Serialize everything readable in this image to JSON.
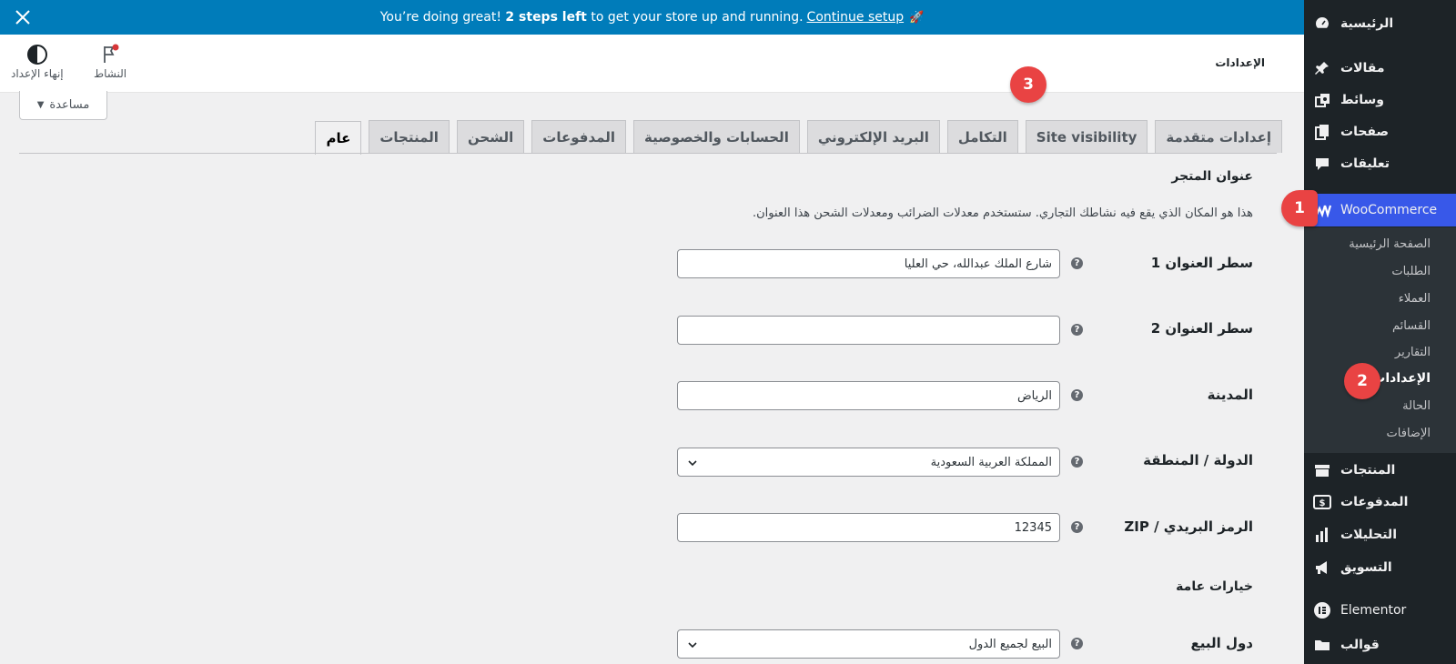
{
  "banner": {
    "text_before": "You’re doing great! ",
    "text_bold": "2 steps left",
    "text_after": " to get your store up and running. ",
    "link": "Continue setup",
    "emoji": "🚀"
  },
  "header": {
    "title": "الإعدادات",
    "activity_label": "النشاط",
    "finish_setup_label": "إنهاء الإعداد",
    "help_label": "مساعدة"
  },
  "tabs": [
    {
      "label": "عام",
      "active": true
    },
    {
      "label": "المنتجات"
    },
    {
      "label": "الشحن"
    },
    {
      "label": "المدفوعات"
    },
    {
      "label": "الحسابات والخصوصية"
    },
    {
      "label": "البريد الإلكتروني"
    },
    {
      "label": "التكامل"
    },
    {
      "label": "Site visibility"
    },
    {
      "label": "إعدادات متقدمة"
    }
  ],
  "store_address": {
    "heading": "عنوان المتجر",
    "description": "هذا هو المكان الذي يقع فيه نشاطك التجاري. ستستخدم معدلات الضرائب ومعدلات الشحن هذا العنوان.",
    "fields": [
      {
        "label": "سطر العنوان 1",
        "value": "شارع الملك عبدالله، حي العليا"
      },
      {
        "label": "سطر العنوان 2",
        "value": ""
      },
      {
        "label": "المدينة",
        "value": "الرياض"
      },
      {
        "label": "الدولة / المنطقة",
        "value": "المملكة العربية السعودية"
      },
      {
        "label": "الرمز البريدي / ZIP",
        "value": "12345"
      }
    ]
  },
  "general_options": {
    "heading": "خيارات عامة",
    "selling_location_label": "دول البيع",
    "selling_location_value": "البيع لجميع الدول"
  },
  "sidebar": {
    "items": [
      {
        "label": "الرئيسية",
        "icon": "dashboard-icon"
      },
      {
        "label": "مقالات",
        "icon": "pin-icon"
      },
      {
        "label": "وسائط",
        "icon": "media-icon"
      },
      {
        "label": "صفحات",
        "icon": "pages-icon"
      },
      {
        "label": "تعليقات",
        "icon": "comments-icon"
      },
      {
        "label": "WooCommerce",
        "icon": "woo-icon"
      },
      {
        "label": "المنتجات",
        "icon": "archive-icon"
      },
      {
        "label": "المدفوعات",
        "icon": "payments-icon"
      },
      {
        "label": "التحليلات",
        "icon": "chart-icon"
      },
      {
        "label": "التسويق",
        "icon": "megaphone-icon"
      },
      {
        "label": "Elementor",
        "icon": "elementor-icon"
      },
      {
        "label": "قوالب",
        "icon": "folder-icon"
      }
    ],
    "woo_submenu": [
      {
        "label": "الصفحة الرئيسية"
      },
      {
        "label": "الطلبات"
      },
      {
        "label": "العملاء"
      },
      {
        "label": "القسائم"
      },
      {
        "label": "التقارير"
      },
      {
        "label": "الإعدادات",
        "current": true
      },
      {
        "label": "الحالة"
      },
      {
        "label": "الإضافات"
      }
    ]
  },
  "markers": [
    "1",
    "2",
    "3"
  ],
  "help_tip": "?",
  "colors": {
    "accent": "#3858e9",
    "banner": "#007cba",
    "marker": "#e94343",
    "sidebar": "#1d2327"
  }
}
